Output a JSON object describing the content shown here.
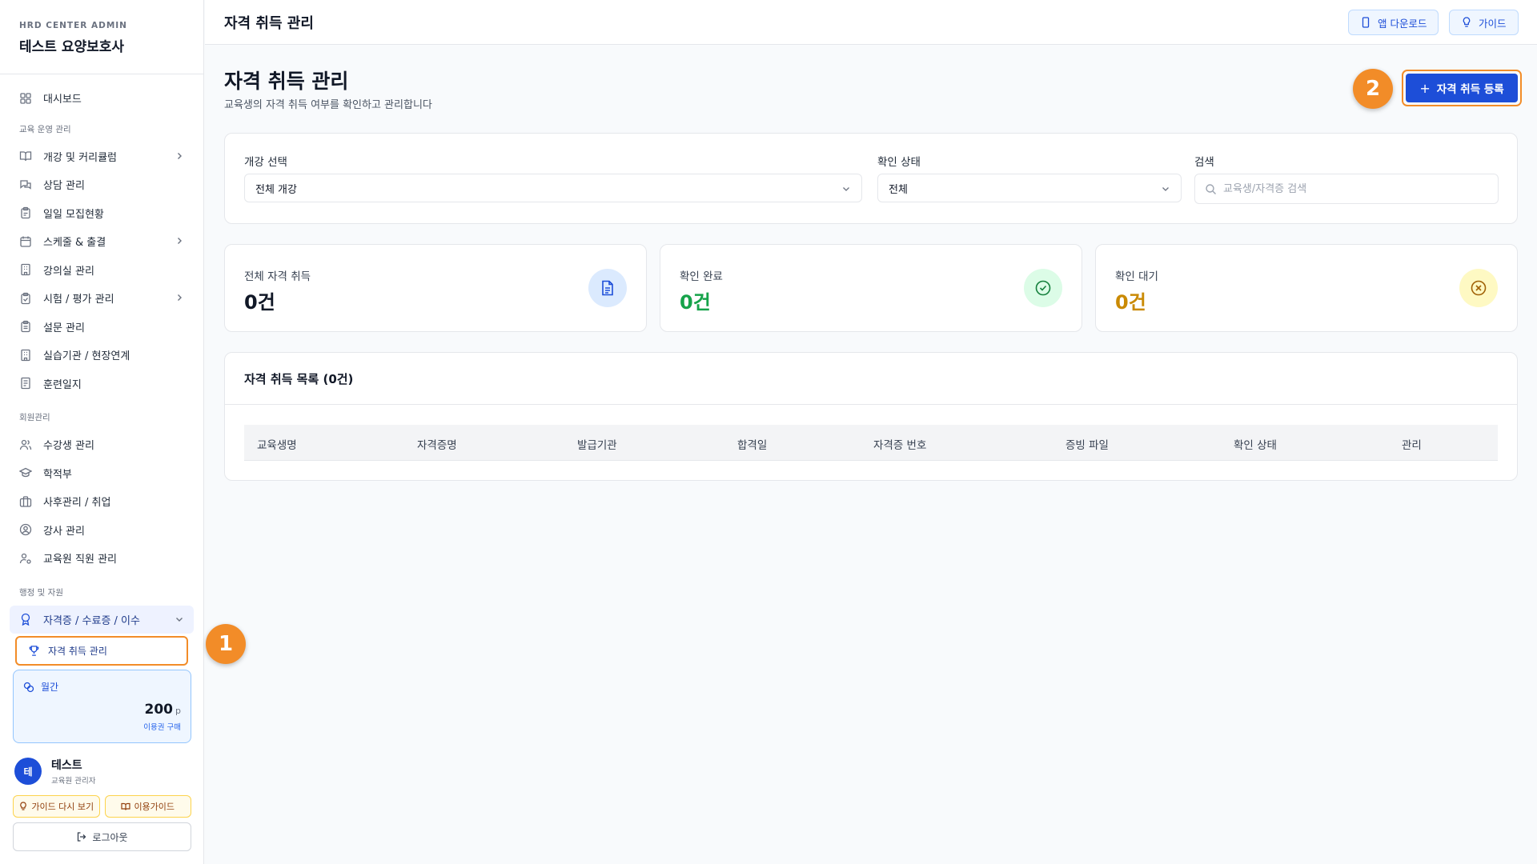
{
  "brand": {
    "sub": "HRD CENTER ADMIN",
    "title": "테스트 요양보호사"
  },
  "nav": {
    "dashboard": "대시보드",
    "section_ops": "교육 운영 관리",
    "courses": "개강 및 커리큘럼",
    "consult": "상담 관리",
    "daily_recruit": "일일 모집현황",
    "schedule": "스케줄 & 출결",
    "classroom": "강의실 관리",
    "exam": "시험 / 평가 관리",
    "survey": "설문 관리",
    "practice": "실습기관 / 현장연계",
    "training_log": "훈련일지",
    "section_members": "회원관리",
    "students": "수강생 관리",
    "registry": "학적부",
    "aftercare": "사후관리 / 취업",
    "instructors": "강사 관리",
    "staff": "교육원 직원 관리",
    "section_admin": "행정 및 자원",
    "certs": "자격증 / 수료증 / 이수",
    "cert_acquire": "자격 취득 관리"
  },
  "points": {
    "label": "월간",
    "value": "200",
    "unit": "p",
    "buy": "이용권 구매"
  },
  "user": {
    "initial": "테",
    "name": "테스트",
    "role": "교육원 관리자"
  },
  "sidebar_buttons": {
    "guide_again": "가이드 다시 보기",
    "usage_guide": "이용가이드",
    "logout": "로그아웃"
  },
  "topbar": {
    "title": "자격 취득 관리",
    "app_download": "앱 다운로드",
    "guide": "가이드"
  },
  "page": {
    "title": "자격 취득 관리",
    "description": "교육생의 자격 취득 여부를 확인하고 관리합니다",
    "register_button": "자격 취득 등록"
  },
  "filters": {
    "course_label": "개강 선택",
    "course_value": "전체 개강",
    "status_label": "확인 상태",
    "status_value": "전체",
    "search_label": "검색",
    "search_placeholder": "교육생/자격증 검색"
  },
  "stats": [
    {
      "label": "전체 자격 취득",
      "value": "0건",
      "color": "#111827",
      "icon_bg": "#dbeafe",
      "icon_color": "#1d4ed8",
      "icon": "document-icon"
    },
    {
      "label": "확인 완료",
      "value": "0건",
      "color": "#16a34a",
      "icon_bg": "#dcfce7",
      "icon_color": "#15803d",
      "icon": "check-circle-icon"
    },
    {
      "label": "확인 대기",
      "value": "0건",
      "color": "#ca8a04",
      "icon_bg": "#fef9c3",
      "icon_color": "#a16207",
      "icon": "x-circle-icon"
    }
  ],
  "list": {
    "title": "자격 취득 목록 (0건)",
    "columns": [
      "교육생명",
      "자격증명",
      "발급기관",
      "합격일",
      "자격증 번호",
      "증빙 파일",
      "확인 상태",
      "관리"
    ]
  },
  "annotations": {
    "step1": "1",
    "step2": "2"
  },
  "colors": {
    "primary": "#1d4ed8",
    "highlight": "#f28c28"
  }
}
